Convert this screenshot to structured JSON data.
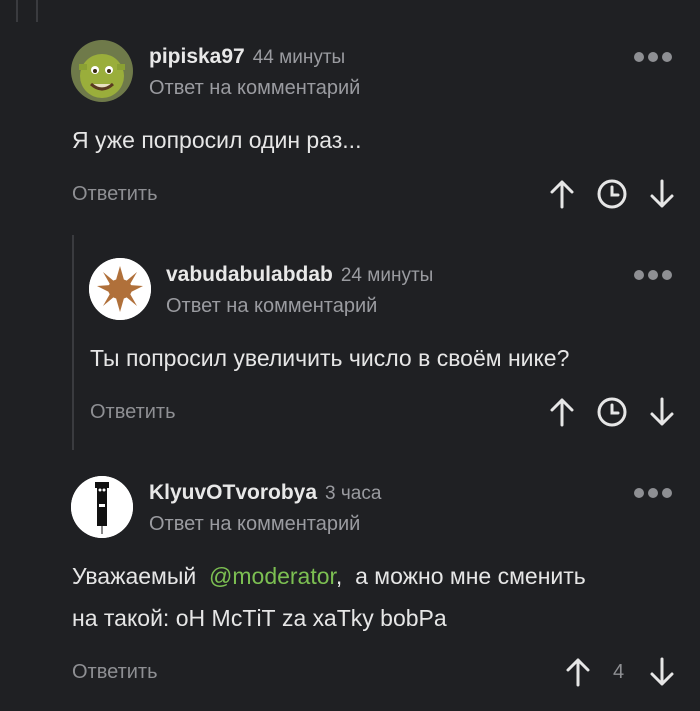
{
  "comments": [
    {
      "username": "pipiska97",
      "time": "44 минуты",
      "reply_to": "Ответ на комментарий",
      "text": "Я уже попросил один раз...",
      "reply_label": "Ответить"
    },
    {
      "username": "vabudabulabdab",
      "time": "24 минуты",
      "reply_to": "Ответ на комментарий",
      "text": "Ты попросил увеличить число в своём нике?",
      "reply_label": "Ответить"
    },
    {
      "username": "KlyuvOTvorobya",
      "time": "3 часа",
      "reply_to": "Ответ на комментарий",
      "text_line1_pre": "Уважаемый ",
      "mention": "@moderator",
      "text_line1_post": ",  а можно мне сменить",
      "text_line2": "на такой: оН МсТiТ za хаТky bobPa",
      "reply_label": "Ответить",
      "rating": "4"
    }
  ],
  "colors": {
    "background": "#1f2023",
    "mention": "#7cbf52",
    "muted": "#9a9ba0"
  }
}
